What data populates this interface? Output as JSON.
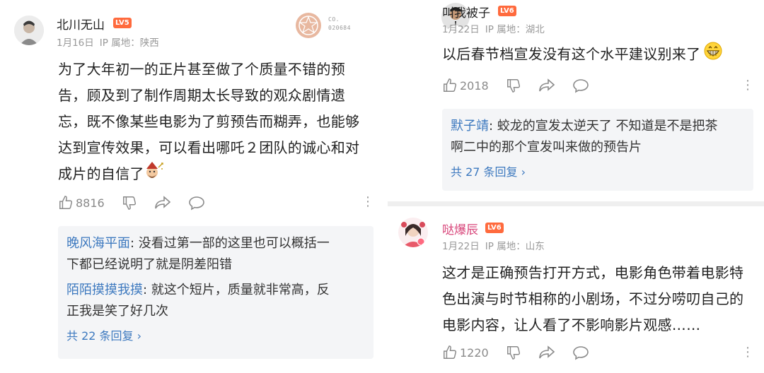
{
  "colors": {
    "link_blue": "#3d79bf",
    "level_badge": "#ff6a3d",
    "meta_gray": "#999999",
    "reply_bg": "#f4f5f7"
  },
  "comments": [
    {
      "username": "北川无山",
      "level": "LV5",
      "date": "1月16日",
      "ip_location": "IP 属地：陕西",
      "stamp_text": "CO. 020684",
      "text_lines": [
        "为了大年初一的正片甚至做了个质量不错的预",
        "告，顾及到了制作周期太长导致的观众剧情遗",
        "忘，既不像某些电影为了剪预告而糊弄，也能够",
        "达到宣传效果，可以看出哪吒２团队的诚心和对",
        "成片的自信了"
      ],
      "likes": "8816",
      "replies": [
        {
          "name": "晚风海平面",
          "text_lines": [
            "没看过第一部的这里也可以概括一",
            "下都已经说明了就是阴差阳错"
          ]
        },
        {
          "name": "陌陌摸摸我摸",
          "text_lines": [
            "就这个短片，质量就非常高，反",
            "正我是笑了好几次"
          ]
        }
      ],
      "reply_count_label": "共 22 条回复",
      "reply_emoji": "wizard-emoji",
      "icons": [
        "thumbs-up-icon",
        "thumbs-down-icon",
        "share-icon",
        "comment-icon",
        "more-icon"
      ]
    },
    {
      "username": "叫我被子",
      "level": "LV6",
      "date": "1月22日",
      "ip_location": "IP 属地：湖北",
      "text_lines": [
        "以后春节档宣发没有这个水平建议别来了"
      ],
      "likes": "2018",
      "replies": [
        {
          "name": "默子靖",
          "text_lines": [
            "蛟龙的宣发太逆天了 不知道是不是把茶",
            "啊二中的那个宣发叫来做的预告片"
          ]
        }
      ],
      "reply_count_label": "共 27 条回复",
      "text_emoji": "grinning-emoji",
      "icons": [
        "thumbs-up-icon",
        "thumbs-down-icon",
        "share-icon",
        "comment-icon",
        "more-icon"
      ]
    },
    {
      "username": "哒爆辰",
      "level": "LV6",
      "date": "1月22日",
      "ip_location": "IP 属地：山东",
      "text_lines": [
        "这才是正确预告打开方式，电影角色带着电影特",
        "色出演与时节相称的小剧场，不过分唠叨自己的",
        "电影内容，让人看了不影响影片观感……"
      ],
      "likes": "1220",
      "icons": [
        "thumbs-up-icon",
        "thumbs-down-icon",
        "share-icon",
        "comment-icon",
        "more-icon"
      ]
    }
  ]
}
